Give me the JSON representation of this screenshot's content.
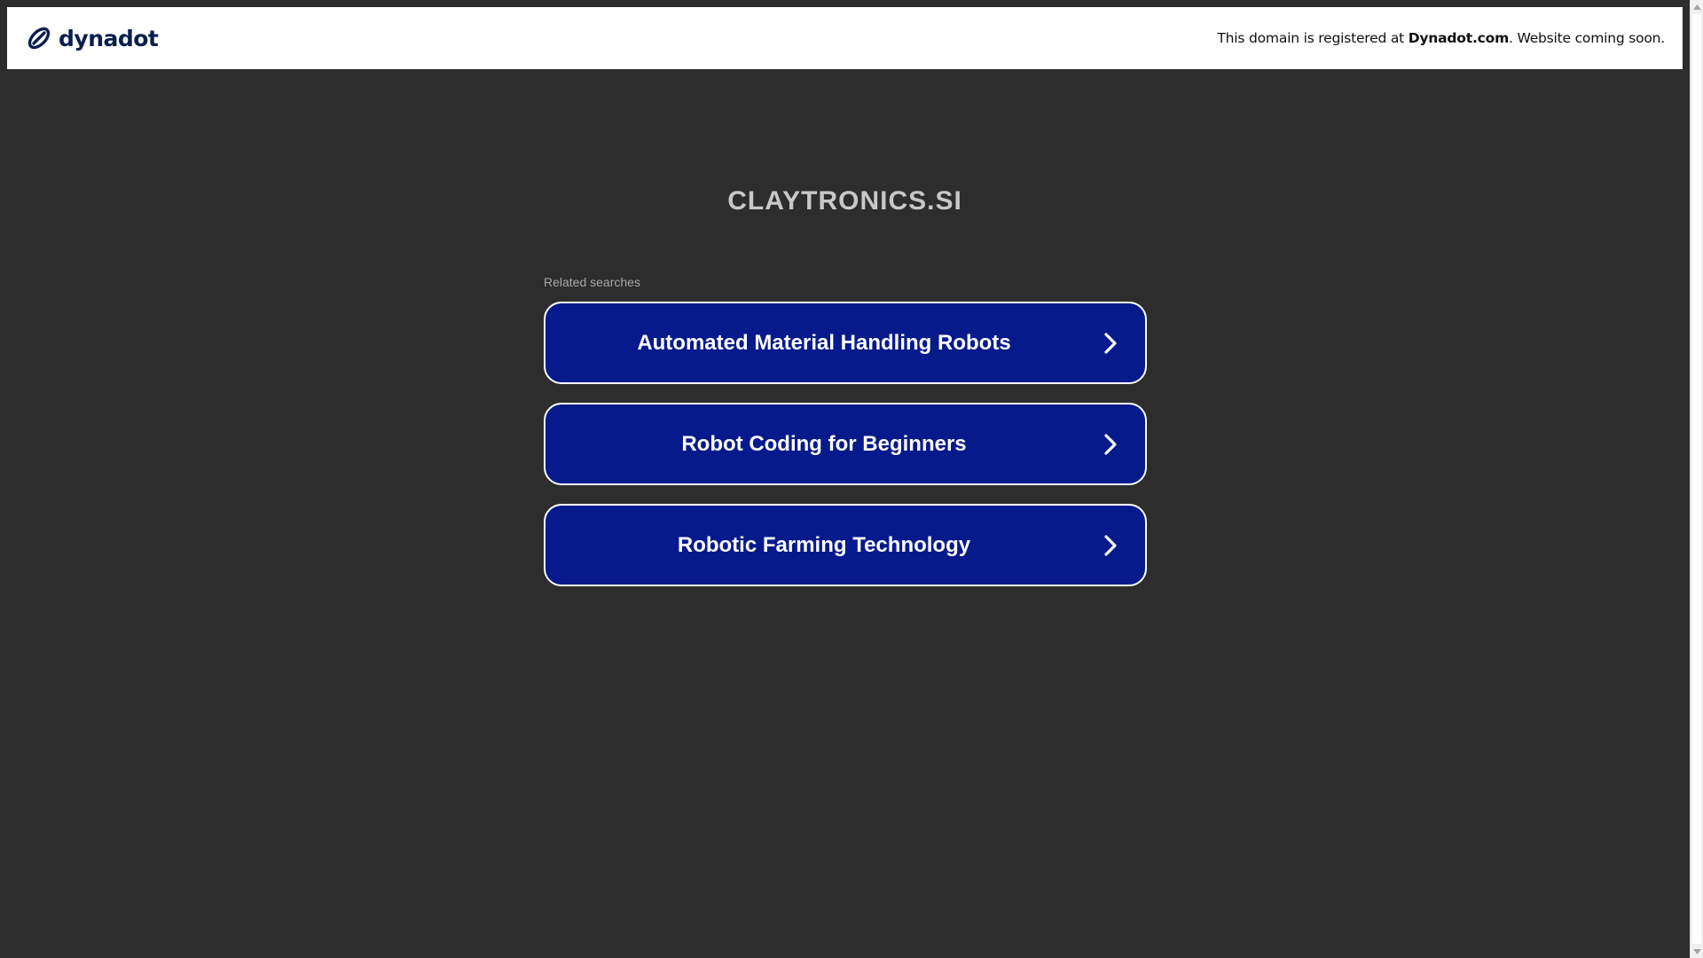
{
  "header": {
    "logo_text": "dynadot",
    "notice_prefix": "This domain is registered at ",
    "notice_link": "Dynadot.com",
    "notice_suffix": ". Website coming soon."
  },
  "main": {
    "domain_name": "CLAYTRONICS.SI",
    "related_label": "Related searches",
    "searches": [
      {
        "label": "Automated Material Handling Robots"
      },
      {
        "label": "Robot Coding for Beginners"
      },
      {
        "label": "Robotic Farming Technology"
      }
    ]
  },
  "colors": {
    "page_background": "#2d2d2d",
    "button_background": "#061a8c",
    "button_border": "#ffffff",
    "brand_navy": "#0b1f4d"
  },
  "icons": {
    "logo": "dynadot-link-icon",
    "button_arrow": "chevron-right-icon"
  }
}
